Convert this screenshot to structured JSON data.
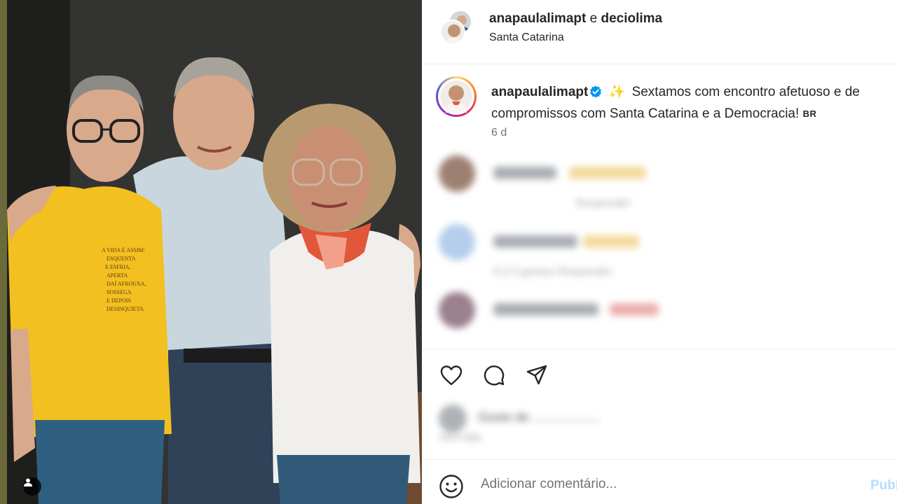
{
  "post": {
    "image_alt": "Foto de três pessoas sorrindo",
    "tag_icon": "user-tag-icon"
  },
  "header": {
    "user1": "anapaulalimapt",
    "connector": "e",
    "user2": "deciolima",
    "location": "Santa Catarina"
  },
  "caption": {
    "username": "anapaulalimapt",
    "verified_icon": "verified-badge-icon",
    "sparkle": "✨",
    "text": "Sextamos com encontro afetuoso e de compromissos com Santa Catarina e a Democracia!",
    "flag": "BR",
    "time": "6 d"
  },
  "comments_blurred": [
    {
      "meta": "Responder"
    },
    {
      "meta": "6 d    3 gostos    Responder"
    },
    {
      "meta": ""
    }
  ],
  "actions": {
    "like_icon": "heart-icon",
    "comment_icon": "comment-icon",
    "share_icon": "share-icon"
  },
  "likes_blurred": {
    "text": "Gosto de ...................",
    "time": "Há 6 dias"
  },
  "comment_bar": {
    "emoji_icon": "emoji-icon",
    "placeholder": "Adicionar comentário...",
    "publish": "Publicar"
  },
  "colors": {
    "accent": "#0095f6",
    "publish_disabled": "#b2dffc",
    "verified": "#0095f6"
  }
}
